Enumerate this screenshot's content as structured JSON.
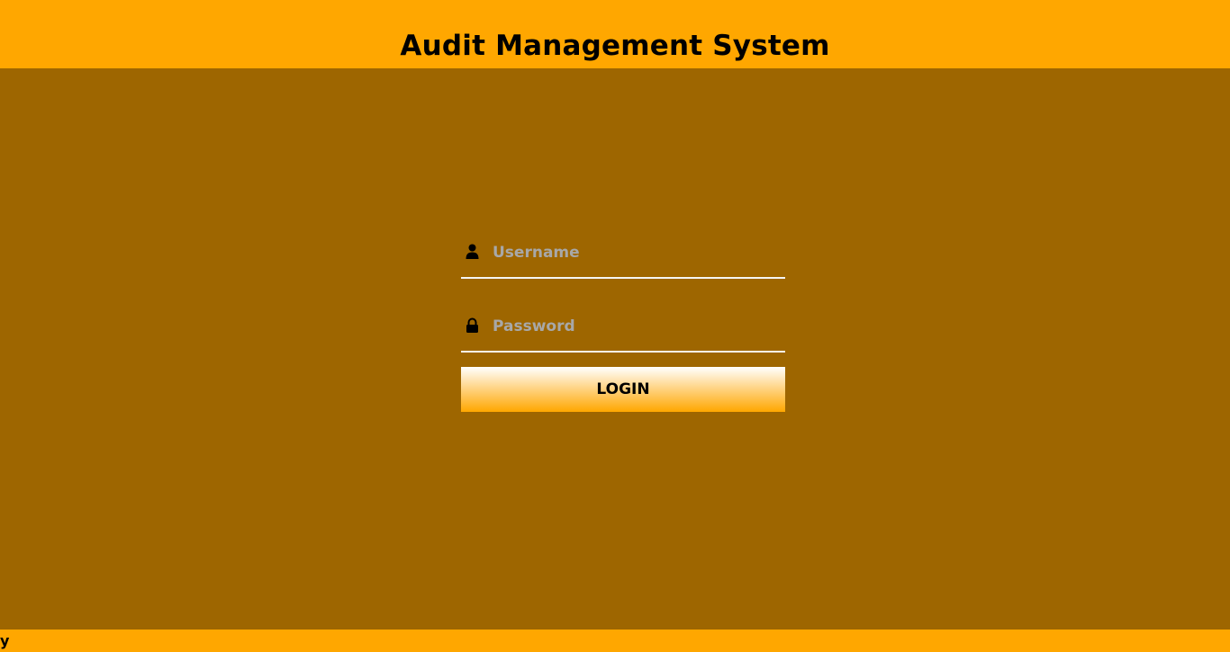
{
  "header": {
    "title": "Audit Management System"
  },
  "login": {
    "username_placeholder": "Username",
    "username_value": "",
    "password_placeholder": "Password",
    "password_value": "",
    "button_label": "LOGIN"
  },
  "footer": {
    "text": "y"
  },
  "icons": {
    "username": "user-icon",
    "password": "lock-icon"
  },
  "colors": {
    "accent": "#ffa700",
    "background": "#9e6600",
    "text": "#000000",
    "placeholder": "#a8a8a8"
  }
}
